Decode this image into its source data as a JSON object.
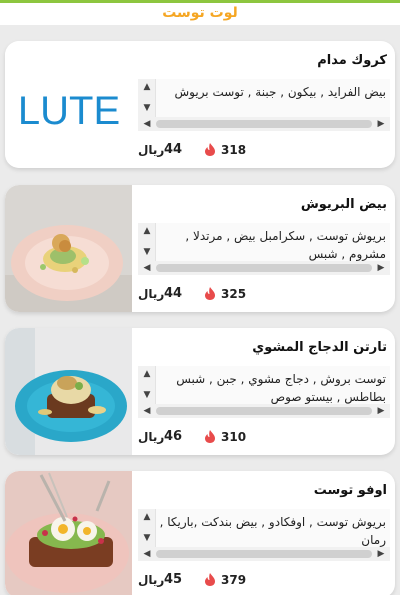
{
  "colors": {
    "accent_line": "#8dc63f",
    "title": "#f5a623",
    "flame": "#e84b4b",
    "logo_blue": "#1b8bcf"
  },
  "header": {
    "title": "لوت توست"
  },
  "items": [
    {
      "name": "كروك مدام",
      "description": "بيض الفرايد , بيكون , جبنة , توست بريوش",
      "calories": "318",
      "price": "44",
      "currency": "ريال",
      "image": "lute-logo",
      "logo_text": "LUTE"
    },
    {
      "name": "بيض البريوش",
      "description": "بريوش توست , سكرامبل بيض , مرتدلا , مشروم , شبس",
      "calories": "325",
      "price": "44",
      "currency": "ريال",
      "image": "brioche-egg-plate-photo"
    },
    {
      "name": "تارتن الدجاج المشوي",
      "description": "توست بروش , دجاج مشوي , جبن , شبس بطاطس , بيستو صوص",
      "calories": "310",
      "price": "46",
      "currency": "ريال",
      "image": "grilled-chicken-tartine-photo"
    },
    {
      "name": "اوفو توست",
      "description": "بريوش توست , اوفكادو , بيض بندكت ,باريكا , رمان",
      "calories": "379",
      "price": "45",
      "currency": "ريال",
      "image": "ovo-toast-photo"
    }
  ]
}
